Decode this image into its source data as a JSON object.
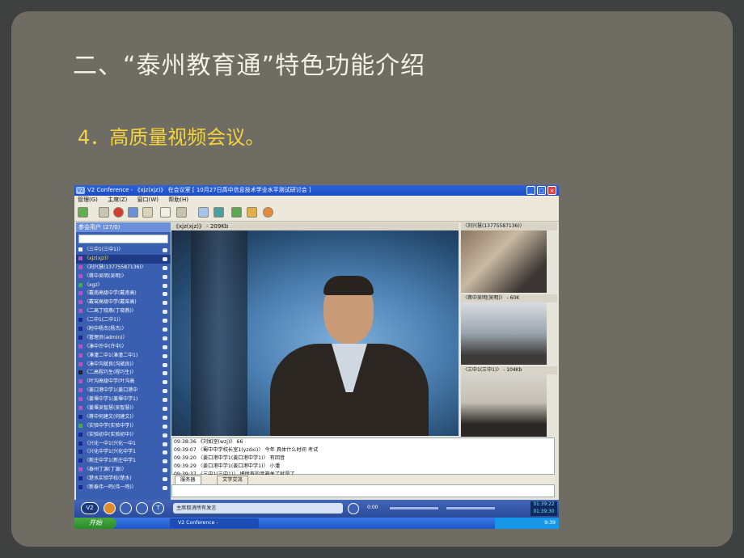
{
  "slide": {
    "title": "二、“泰州教育通”特色功能介绍",
    "subtitle": "4．高质量视频会议。"
  },
  "window": {
    "title": "V2 Conference - 《xjz(xjz)》 在会议室 [ 10月27日高中信息技术学业水平测试研讨会 ]",
    "menu": [
      "管理(G)",
      "主席(Z)",
      "窗口(W)",
      "帮助(H)"
    ]
  },
  "user_panel": {
    "header": "参会用户 (27/0)",
    "users": [
      {
        "name": "〈三中1(三中1)〉",
        "color": "#ffffff"
      },
      {
        "name": "〈xjz(xjz)〉",
        "color": "#c050c0",
        "selected": true
      },
      {
        "name": "〈刘兴慧(13775587136)〉",
        "color": "#c050c0"
      },
      {
        "name": "〈蒋中吴明(吴明)〉",
        "color": "#c050c0"
      },
      {
        "name": "〈xgz〉",
        "color": "#40b040"
      },
      {
        "name": "〈戴南高级中学(戴南高)",
        "color": "#c050c0"
      },
      {
        "name": "〈戴窑高级中学(戴窑高)",
        "color": "#c050c0"
      },
      {
        "name": "〈二高丁晓燕(丁晓燕)〉",
        "color": "#c050c0"
      },
      {
        "name": "〈二中1(二中1)〉",
        "color": "#2020a0"
      },
      {
        "name": "〈附中杨杰(杨杰)〉",
        "color": "#2020a0"
      },
      {
        "name": "〈管理员(admin)〉",
        "color": "#2020a0"
      },
      {
        "name": "〈溱中许中(许中)〉",
        "color": "#c050c0"
      },
      {
        "name": "〈溱潼二中1(溱潼二中1)",
        "color": "#c050c0"
      },
      {
        "name": "〈溱中沟斌良(沟斌良)〉",
        "color": "#c050c0"
      },
      {
        "name": "〈二高程巧生(程巧生)〉",
        "color": "#202020"
      },
      {
        "name": "〈叶沟高级中学(叶沟高",
        "color": "#c050c0"
      },
      {
        "name": "〈姜口港中学1(姜口港中",
        "color": "#c050c0"
      },
      {
        "name": "〈姜堰中学1(姜堰中学1)",
        "color": "#c050c0"
      },
      {
        "name": "〈姜堰吴智慧(吴智慧)〉",
        "color": "#c050c0"
      },
      {
        "name": "〈蒋中何建文(何建文)〉",
        "color": "#2020a0"
      },
      {
        "name": "〈实验中学(实验中学)〉",
        "color": "#40b040"
      },
      {
        "name": "〈实验初中(实验初中)〉",
        "color": "#2020a0"
      },
      {
        "name": "〈兴化一中1(兴化一中1",
        "color": "#2020a0"
      },
      {
        "name": "〈兴化中学1(兴化中学1",
        "color": "#2020a0"
      },
      {
        "name": "〈新庄中学1(新庄中学1",
        "color": "#2020a0"
      },
      {
        "name": "〈泰州丁源(丁源)〉",
        "color": "#c050c0"
      },
      {
        "name": "〈楚水实验学校(楚水)",
        "color": "#2020a0"
      },
      {
        "name": "〈新泰伟一鸣(伟一鸣)〉",
        "color": "#2020a0"
      }
    ]
  },
  "main_video": {
    "label": "《xjz(xjz)》 - 209Kb"
  },
  "side_videos": [
    {
      "label": "〈刘兴慧(13775587136)〉"
    },
    {
      "label": "〈蒋中吴明(吴明)〉 - 60K"
    },
    {
      "label": "〈三中1(三中1)〉 - 104Kb"
    }
  ],
  "chat": {
    "lines": [
      "09:38:36  《刘如坚(wzj)》  66",
      "09:39:07  〈蜀中中学校长室1(yzdxi)〉 今年 具体什么时间 考试",
      "09:39:20  〈姜口港中学1(姜口港中学1)〉 有回音",
      "09:39:29  〈姜口港中学1(姜口港中学1)〉 小潘",
      "09:39:37  〈三中1(三中1)〉 把所有的音箱关了就是了"
    ],
    "tabs": [
      "服务器",
      "文字交流"
    ]
  },
  "bottom": {
    "search_text": "主席取消所有发言",
    "time_a": "01:39:22",
    "time_b": "01:39:30",
    "level": "0:00"
  },
  "taskbar": {
    "start": "开始",
    "task": "V2 Conference -",
    "clock": "9:39"
  }
}
